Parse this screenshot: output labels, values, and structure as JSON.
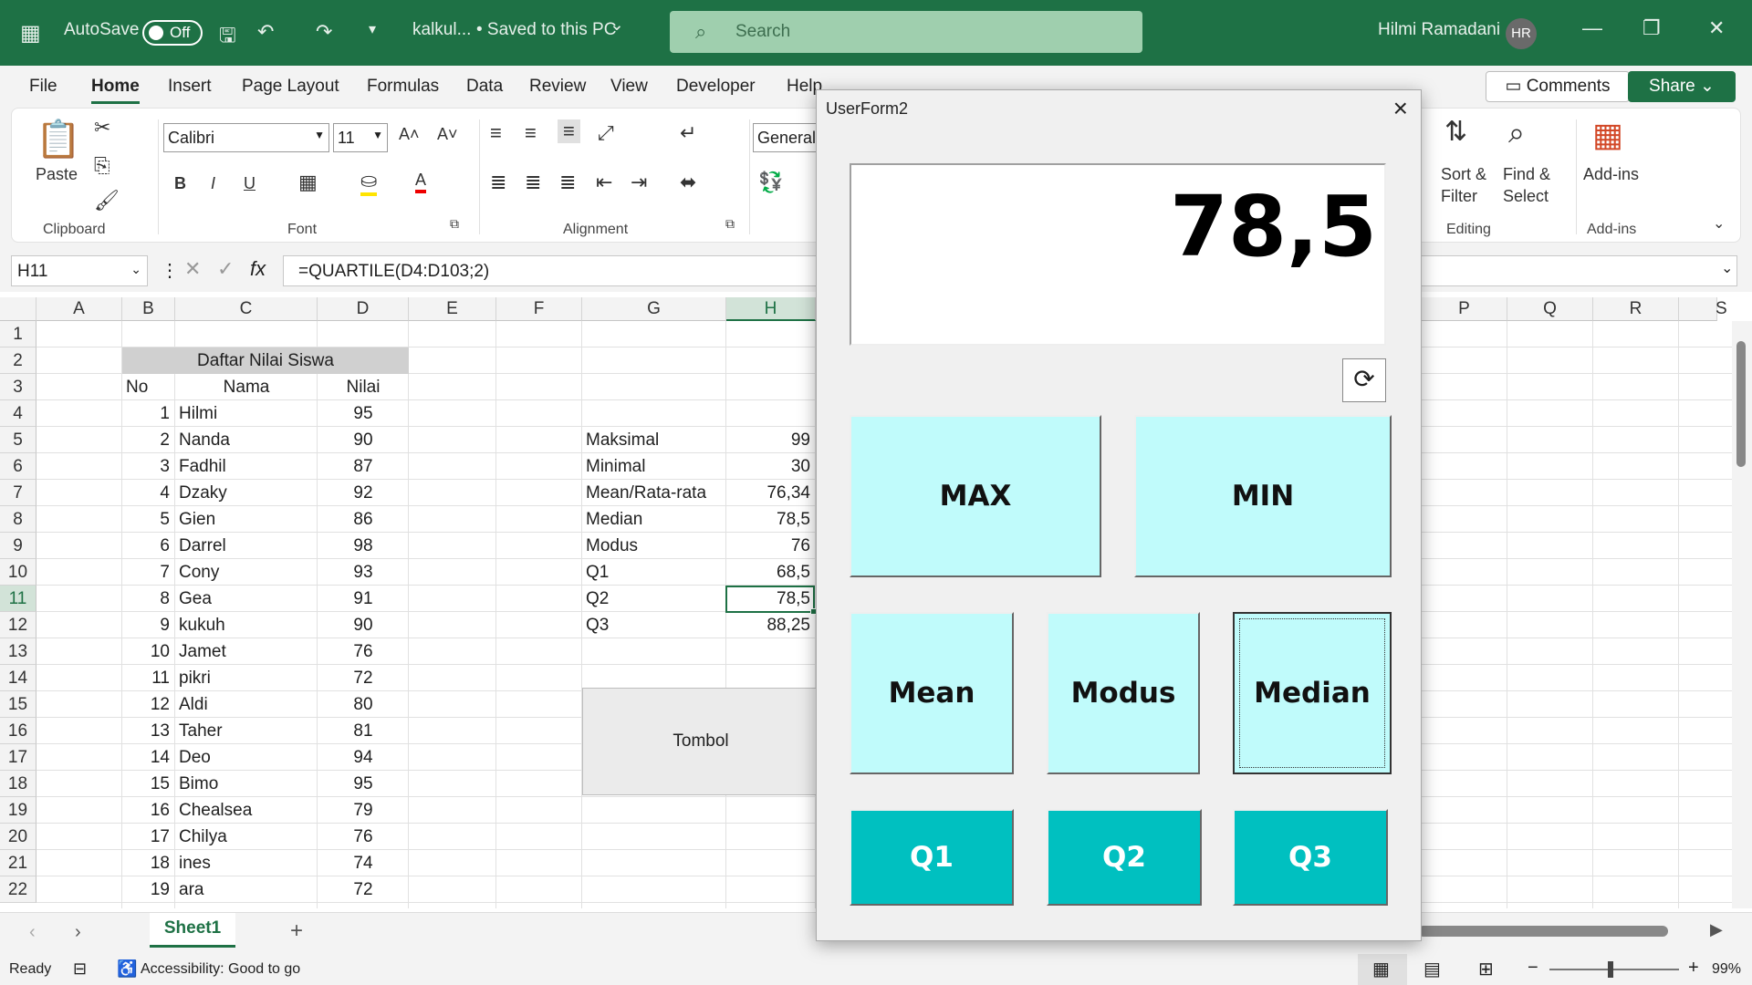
{
  "titlebar": {
    "autosave": "AutoSave",
    "toggle": "Off",
    "doc": "kalkul...",
    "saved": "•  Saved to this PC",
    "saved_caret": "⌄",
    "search_placeholder": "Search",
    "user": "Hilmi Ramadani",
    "initials": "HR"
  },
  "menu": [
    "File",
    "Home",
    "Insert",
    "Page Layout",
    "Formulas",
    "Data",
    "Review",
    "View",
    "Developer",
    "Help"
  ],
  "buttons": {
    "comments": "Comments",
    "share": "Share"
  },
  "ribbon": {
    "paste": "Paste",
    "clipboard": "Clipboard",
    "font_name": "Calibri",
    "font_size": "11",
    "font": "Font",
    "alignment": "Alignment",
    "number_format": "General",
    "sort": "Sort &",
    "filter": "Filter",
    "find": "Find &",
    "select": "Select",
    "editing": "Editing",
    "addins": "Add-ins",
    "addins_group": "Add-ins",
    "bold": "B",
    "italic": "I",
    "underline": "U",
    "font_color": "A"
  },
  "formula_bar": {
    "cell": "H11",
    "formula": "=QUARTILE(D4:D103;2)",
    "fx": "fx"
  },
  "columns": [
    "A",
    "B",
    "C",
    "D",
    "E",
    "F",
    "G",
    "H",
    "",
    "",
    "",
    "",
    "",
    "",
    "P",
    "Q",
    "R",
    "S"
  ],
  "rows": [
    "1",
    "2",
    "3",
    "4",
    "5",
    "6",
    "7",
    "8",
    "9",
    "10",
    "11",
    "12",
    "13",
    "14",
    "15",
    "16",
    "17",
    "18",
    "19",
    "20",
    "21",
    "22"
  ],
  "table": {
    "title": "Daftar Nilai Siswa",
    "headers": [
      "No",
      "Nama",
      "Nilai"
    ],
    "rows": [
      [
        "1",
        "Hilmi",
        "95"
      ],
      [
        "2",
        "Nanda",
        "90"
      ],
      [
        "3",
        "Fadhil",
        "87"
      ],
      [
        "4",
        "Dzaky",
        "92"
      ],
      [
        "5",
        "Gien",
        "86"
      ],
      [
        "6",
        "Darrel",
        "98"
      ],
      [
        "7",
        "Cony",
        "93"
      ],
      [
        "8",
        "Gea",
        "91"
      ],
      [
        "9",
        "kukuh",
        "90"
      ],
      [
        "10",
        "Jamet",
        "76"
      ],
      [
        "11",
        "pikri",
        "72"
      ],
      [
        "12",
        "Aldi",
        "80"
      ],
      [
        "13",
        "Taher",
        "81"
      ],
      [
        "14",
        "Deo",
        "94"
      ],
      [
        "15",
        "Bimo",
        "95"
      ],
      [
        "16",
        "Chealsea",
        "79"
      ],
      [
        "17",
        "Chilya",
        "76"
      ],
      [
        "18",
        "ines",
        "74"
      ],
      [
        "19",
        "ara",
        "72"
      ]
    ]
  },
  "stats": [
    [
      "Maksimal",
      "99"
    ],
    [
      "Minimal",
      "30"
    ],
    [
      "Mean/Rata-rata",
      "76,34"
    ],
    [
      "Median",
      "78,5"
    ],
    [
      "Modus",
      "76"
    ],
    [
      "Q1",
      "68,5"
    ],
    [
      "Q2",
      "78,5"
    ],
    [
      "Q3",
      "88,25"
    ]
  ],
  "shape_label": "Tombol",
  "sheet_tab": "Sheet1",
  "status": {
    "ready": "Ready",
    "accessibility": "Accessibility: Good to go",
    "zoom": "99%"
  },
  "userform": {
    "title": "UserForm2",
    "display": "78,5",
    "max": "MAX",
    "min": "MIN",
    "mean": "Mean",
    "modus": "Modus",
    "median": "Median",
    "q1": "Q1",
    "q2": "Q2",
    "q3": "Q3"
  }
}
